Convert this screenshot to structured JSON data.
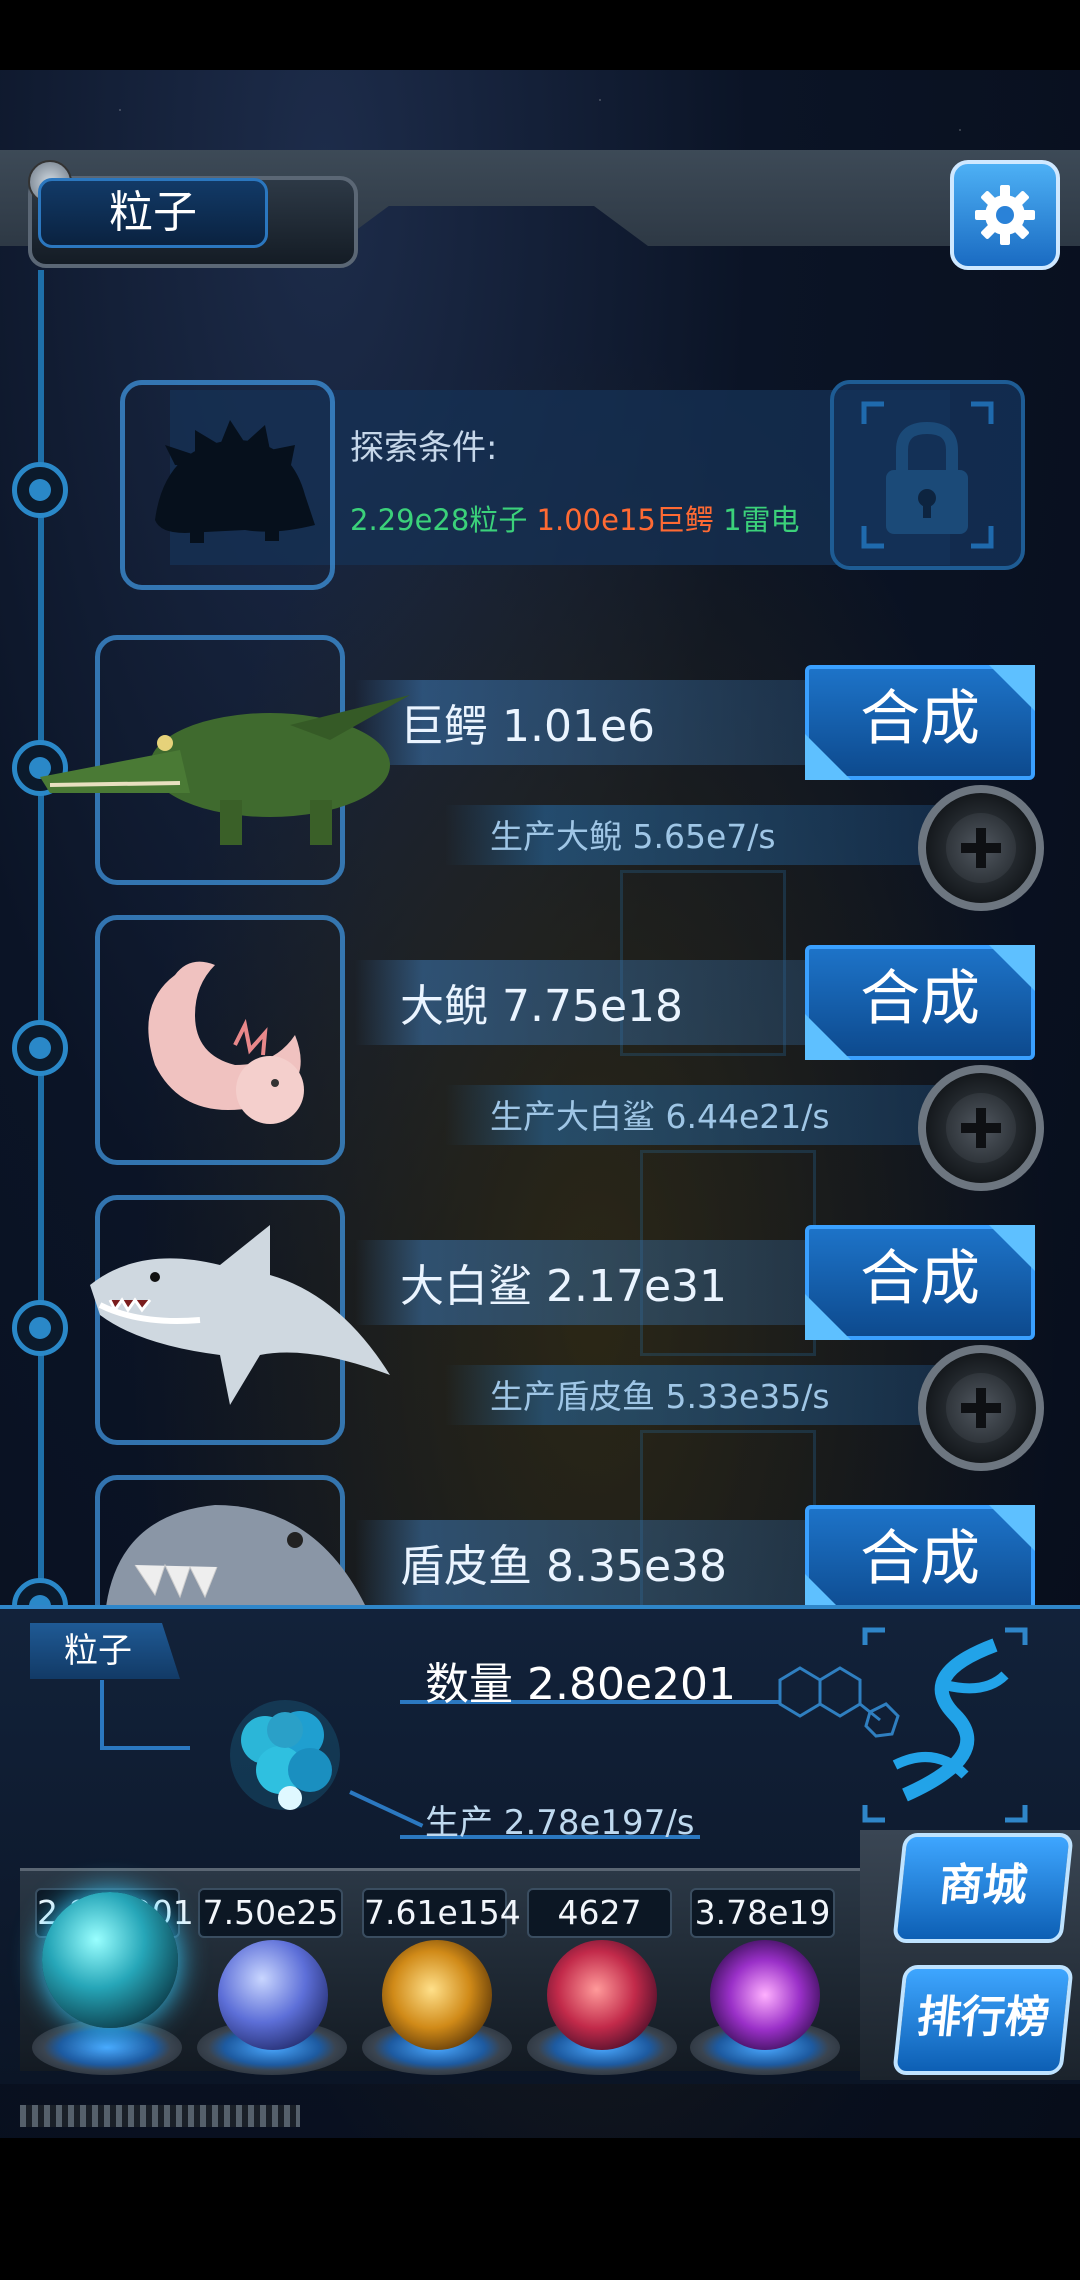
{
  "header": {
    "resource_label": "粒子",
    "settings_icon": "gear-icon"
  },
  "locked": {
    "condition_title": "探索条件:",
    "req_particles": "2.29e28粒子",
    "req_crocodile": "1.00e15巨鳄",
    "req_thunder": "1雷电"
  },
  "species": [
    {
      "name": "巨鳄 1.01e6",
      "production": "生产大鲵 5.65e7/s",
      "merge_label": "合成"
    },
    {
      "name": "大鲵 7.75e18",
      "production": "生产大白鲨 6.44e21/s",
      "merge_label": "合成"
    },
    {
      "name": "大白鲨 2.17e31",
      "production": "生产盾皮鱼 5.33e35/s",
      "merge_label": "合成"
    },
    {
      "name": "盾皮鱼 8.35e38",
      "merge_label": "合成"
    }
  ],
  "panel": {
    "tag": "粒子",
    "count": "数量 2.80e201",
    "production": "生产 2.78e197/s"
  },
  "resources": [
    {
      "count": "2.80e201",
      "orb": "particle-orb-icon"
    },
    {
      "count": "7.50e25",
      "orb": "lightning-orb-icon"
    },
    {
      "count": "7.61e154",
      "orb": "fire-orb-icon"
    },
    {
      "count": "4627",
      "orb": "brain-orb-icon"
    },
    {
      "count": "3.78e19",
      "orb": "vortex-orb-icon"
    }
  ],
  "side": {
    "shop": "商城",
    "ranking": "排行榜"
  },
  "colors": {
    "accent": "#2a88c8",
    "condition_green": "#3bd17a",
    "condition_orange": "#ff6a33"
  }
}
